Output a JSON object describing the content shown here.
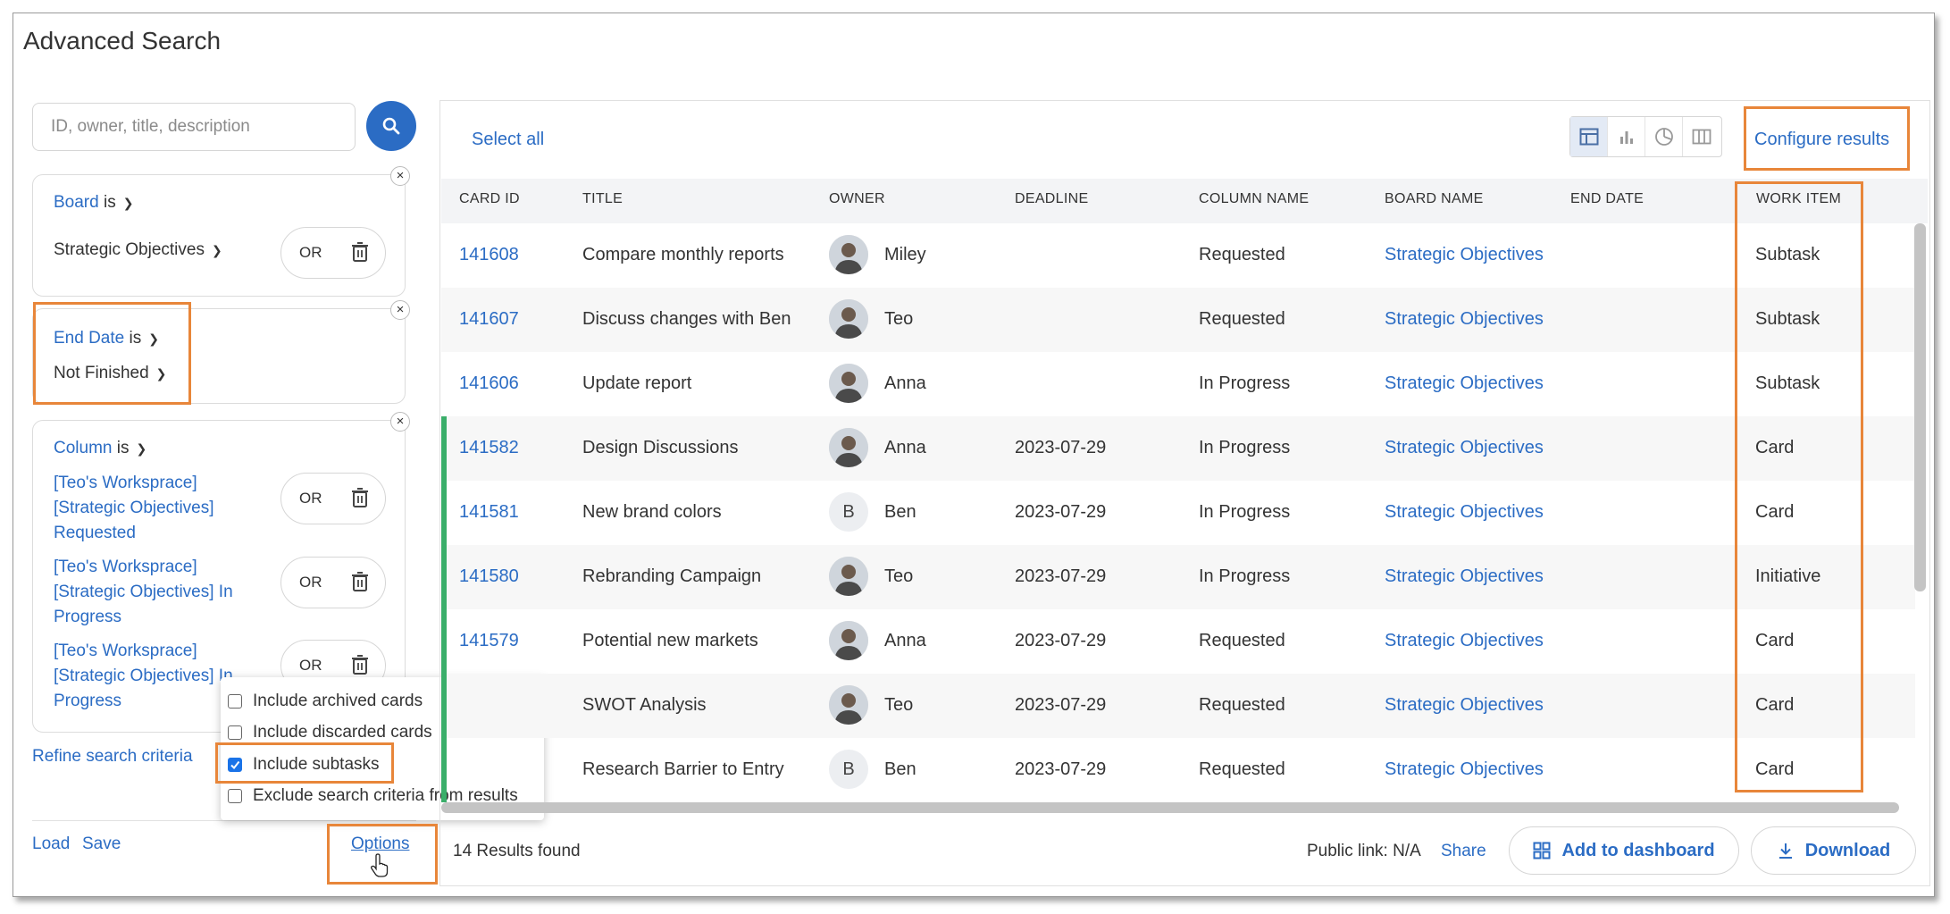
{
  "page": {
    "title": "Advanced Search"
  },
  "search": {
    "placeholder": "ID, owner, title, description"
  },
  "filters": {
    "board": {
      "field": "Board",
      "operator": "is",
      "value": "Strategic Objectives",
      "or_label": "OR"
    },
    "end_date": {
      "field": "End Date",
      "operator": "is",
      "value": "Not Finished"
    },
    "column": {
      "field": "Column",
      "operator": "is",
      "values": [
        {
          "label": "[Teo's Worksprace] [Strategic Objectives] Requested",
          "or_label": "OR"
        },
        {
          "label": "[Teo's Worksprace] [Strategic Objectives] In Progress",
          "or_label": "OR"
        },
        {
          "label": "[Teo's Worksprace] [Strategic Objectives] In Progress",
          "or_label": "OR"
        }
      ]
    }
  },
  "left_footer": {
    "refine": "Refine search criteria",
    "load": "Load",
    "save": "Save",
    "options": "Options"
  },
  "options_menu": [
    {
      "label": "Include archived cards",
      "checked": false
    },
    {
      "label": "Include discarded cards",
      "checked": false
    },
    {
      "label": "Include subtasks",
      "checked": true
    },
    {
      "label": "Exclude search criteria from results",
      "checked": false
    }
  ],
  "toolbar": {
    "select_all": "Select all",
    "configure": "Configure results",
    "view_icons": [
      "table-view-icon",
      "bar-chart-icon",
      "pie-chart-icon",
      "columns-view-icon"
    ]
  },
  "table": {
    "headers": [
      "CARD ID",
      "TITLE",
      "OWNER",
      "DEADLINE",
      "COLUMN NAME",
      "BOARD NAME",
      "END DATE",
      "WORK ITEM"
    ],
    "rows": [
      {
        "id": "141608",
        "title": "Compare monthly reports",
        "owner": "Miley",
        "avatar": "photo",
        "deadline": "",
        "column": "Requested",
        "board": "Strategic Objectives",
        "end_date": "",
        "work_item": "Subtask",
        "bar": false
      },
      {
        "id": "141607",
        "title": "Discuss changes with Ben",
        "owner": "Teo",
        "avatar": "photo",
        "deadline": "",
        "column": "Requested",
        "board": "Strategic Objectives",
        "end_date": "",
        "work_item": "Subtask",
        "bar": false
      },
      {
        "id": "141606",
        "title": "Update report",
        "owner": "Anna",
        "avatar": "photo",
        "deadline": "",
        "column": "In Progress",
        "board": "Strategic Objectives",
        "end_date": "",
        "work_item": "Subtask",
        "bar": false
      },
      {
        "id": "141582",
        "title": "Design Discussions",
        "owner": "Anna",
        "avatar": "photo",
        "deadline": "2023-07-29",
        "column": "In Progress",
        "board": "Strategic Objectives",
        "end_date": "",
        "work_item": "Card",
        "bar": true
      },
      {
        "id": "141581",
        "title": "New brand colors",
        "owner": "Ben",
        "avatar": "B",
        "deadline": "2023-07-29",
        "column": "In Progress",
        "board": "Strategic Objectives",
        "end_date": "",
        "work_item": "Card",
        "bar": true
      },
      {
        "id": "141580",
        "title": "Rebranding Campaign",
        "owner": "Teo",
        "avatar": "photo",
        "deadline": "2023-07-29",
        "column": "In Progress",
        "board": "Strategic Objectives",
        "end_date": "",
        "work_item": "Initiative",
        "bar": true
      },
      {
        "id": "141579",
        "title": "Potential new markets",
        "owner": "Anna",
        "avatar": "photo",
        "deadline": "2023-07-29",
        "column": "Requested",
        "board": "Strategic Objectives",
        "end_date": "",
        "work_item": "Card",
        "bar": true
      },
      {
        "id": "",
        "title": "SWOT Analysis",
        "owner": "Teo",
        "avatar": "photo",
        "deadline": "2023-07-29",
        "column": "Requested",
        "board": "Strategic Objectives",
        "end_date": "",
        "work_item": "Card",
        "bar": true
      },
      {
        "id": "",
        "title": "Research Barrier to Entry",
        "owner": "Ben",
        "avatar": "B",
        "deadline": "2023-07-29",
        "column": "Requested",
        "board": "Strategic Objectives",
        "end_date": "",
        "work_item": "Card",
        "bar": true
      }
    ]
  },
  "footer": {
    "results_found": "14 Results found",
    "public_link": "Public link: N/A",
    "share": "Share",
    "add_to_dashboard": "Add to dashboard",
    "download": "Download"
  },
  "colors": {
    "accent": "#2b6cc4",
    "highlight": "#e8863a",
    "status_bar": "#3aae6a"
  }
}
